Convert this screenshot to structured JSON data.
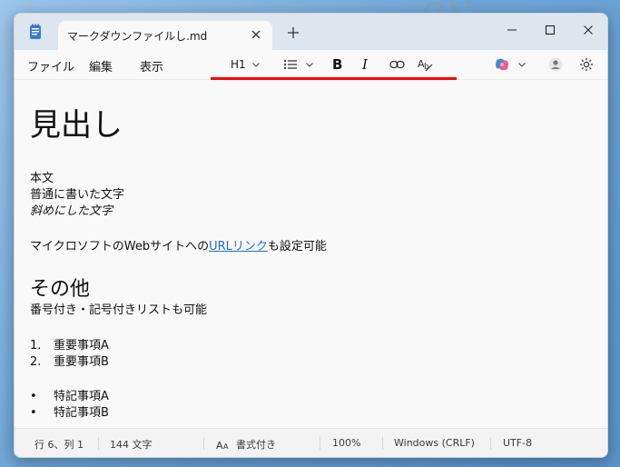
{
  "window": {
    "tab_title": "マークダウンファイルし.md"
  },
  "menu": {
    "file": "ファイル",
    "edit": "編集",
    "view": "表示"
  },
  "toolbar": {
    "heading_label": "H1"
  },
  "document": {
    "heading1": "見出し",
    "para1": "本文",
    "para2": "普通に書いた文字",
    "para3_italic": "斜めにした文字",
    "para4_before": "マイクロソフトのWebサイトへの",
    "para4_link": "URLリンク",
    "para4_after": "も設定可能",
    "heading2": "その他",
    "para5": "番号付き・記号付きリストも可能",
    "ordered_list": [
      {
        "marker": "1.",
        "text": "重要事項A"
      },
      {
        "marker": "2.",
        "text": "重要事項B"
      }
    ],
    "bullet_list": [
      {
        "marker": "•",
        "text": "特記事項A"
      },
      {
        "marker": "•",
        "text": "特記事項B"
      }
    ]
  },
  "status": {
    "position": "行 6、列 1",
    "char_count": "144 文字",
    "format_mode": "書式付き",
    "zoom": "100%",
    "line_ending": "Windows (CRLF)",
    "encoding": "UTF-8"
  },
  "watermark": "www.nichepcgamer.com",
  "colors": {
    "accent_red": "#ff0000",
    "link": "#1a6fd8"
  },
  "icons": {
    "app": "notepad-icon",
    "tab_close": "close-icon",
    "new_tab": "plus-icon",
    "list": "list-icon",
    "link": "link-icon",
    "clear_format": "clear-formatting-icon",
    "copilot": "copilot-icon",
    "account": "avatar-icon",
    "settings": "gear-icon"
  }
}
